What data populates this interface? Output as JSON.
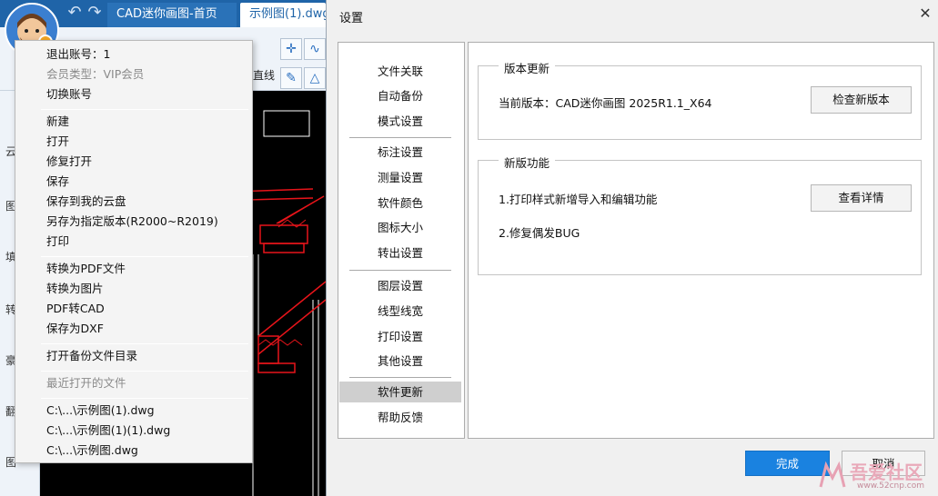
{
  "app": {
    "tabs": [
      "CAD迷你画图-首页",
      "示例图(1).dwg"
    ],
    "ribbon_label": "直线"
  },
  "left_toolbar": [
    "云",
    "图",
    "填",
    "转",
    "豪",
    "翻",
    "图"
  ],
  "file_menu": {
    "account": [
      "退出账号：1",
      "会员类型：VIP会员",
      "切换账号"
    ],
    "file_ops": [
      "新建",
      "打开",
      "修复打开",
      "保存",
      "保存到我的云盘",
      "另存为指定版本(R2000~R2019)",
      "打印"
    ],
    "convert": [
      "转换为PDF文件",
      "转换为图片",
      "PDF转CAD",
      "保存为DXF"
    ],
    "backup": "打开备份文件目录",
    "recent_header": "最近打开的文件",
    "recent_files": [
      "C:\\...\\示例图(1).dwg",
      "C:\\...\\示例图(1)(1).dwg",
      "C:\\...\\示例图.dwg"
    ]
  },
  "dialog": {
    "title": "设置",
    "nav_groups": [
      [
        "文件关联",
        "自动备份",
        "模式设置"
      ],
      [
        "标注设置",
        "测量设置",
        "软件颜色",
        "图标大小",
        "转出设置"
      ],
      [
        "图层设置",
        "线型线宽",
        "打印设置",
        "其他设置"
      ],
      [
        "软件更新",
        "帮助反馈"
      ]
    ],
    "selected_nav": "软件更新",
    "version_group": {
      "title": "版本更新",
      "current_version": "当前版本：CAD迷你画图 2025R1.1_X64",
      "check_button": "检查新版本"
    },
    "features_group": {
      "title": "新版功能",
      "items": [
        "1.打印样式新增导入和编辑功能",
        "2.修复偶发BUG"
      ],
      "details_button": "查看详情"
    },
    "done_button": "完成",
    "cancel_button": "取消"
  },
  "watermark": {
    "text": "吾爱社区",
    "url": "www.52cnp.com"
  },
  "colors": {
    "title_blue": "#1f64a8",
    "accent": "#1a82e0",
    "cad_red": "#e8141a"
  }
}
